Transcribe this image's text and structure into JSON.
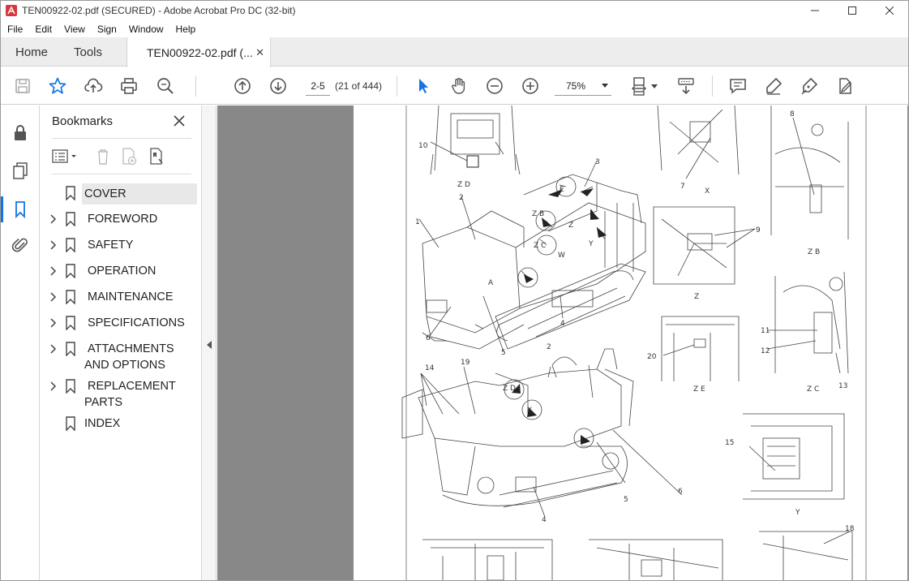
{
  "window": {
    "title": "TEN00922-02.pdf (SECURED) - Adobe Acrobat Pro DC (32-bit)"
  },
  "menu": [
    "File",
    "Edit",
    "View",
    "Sign",
    "Window",
    "Help"
  ],
  "tabs": {
    "home": "Home",
    "tools": "Tools",
    "document": "TEN00922-02.pdf (..."
  },
  "toolbar": {
    "page_input": "2-5",
    "page_count": "(21 of 444)",
    "zoom": "75%"
  },
  "bookmarks": {
    "title": "Bookmarks",
    "items": [
      {
        "label": "COVER",
        "expandable": false,
        "selected": true
      },
      {
        "label": "FOREWORD",
        "expandable": true
      },
      {
        "label": "SAFETY",
        "expandable": true
      },
      {
        "label": "OPERATION",
        "expandable": true
      },
      {
        "label": "MAINTENANCE",
        "expandable": true
      },
      {
        "label": "SPECIFICATIONS",
        "expandable": true
      },
      {
        "label": "ATTACHMENTS AND OPTIONS",
        "line1": "ATTACHMENTS",
        "line2": "AND OPTIONS",
        "expandable": true
      },
      {
        "label": "REPLACEMENT PARTS",
        "line1": "REPLACEMENT",
        "line2": "PARTS",
        "expandable": true
      },
      {
        "label": "INDEX",
        "expandable": false
      }
    ]
  },
  "drawing_labels": {
    "zd": "Z D",
    "x": "X",
    "zb": "Z B",
    "z": "Z",
    "ze": "Z E",
    "zc": "Z C",
    "y": "Y",
    "n1": "1",
    "n2": "2",
    "n3": "3",
    "n4": "4",
    "n5": "5",
    "n6": "6",
    "n7": "7",
    "n8": "8",
    "n9": "9",
    "n10": "10",
    "n11": "11",
    "n12": "12",
    "n13": "13",
    "n14": "14",
    "n15": "15",
    "n18": "18",
    "n19": "19",
    "n20": "20",
    "a": "A",
    "b": "B",
    "c": "C",
    "e": "E",
    "w": "W"
  },
  "colors": {
    "accent": "#1473e6",
    "viewer_bg": "#888888",
    "acrobat_red": "#d7373f"
  }
}
